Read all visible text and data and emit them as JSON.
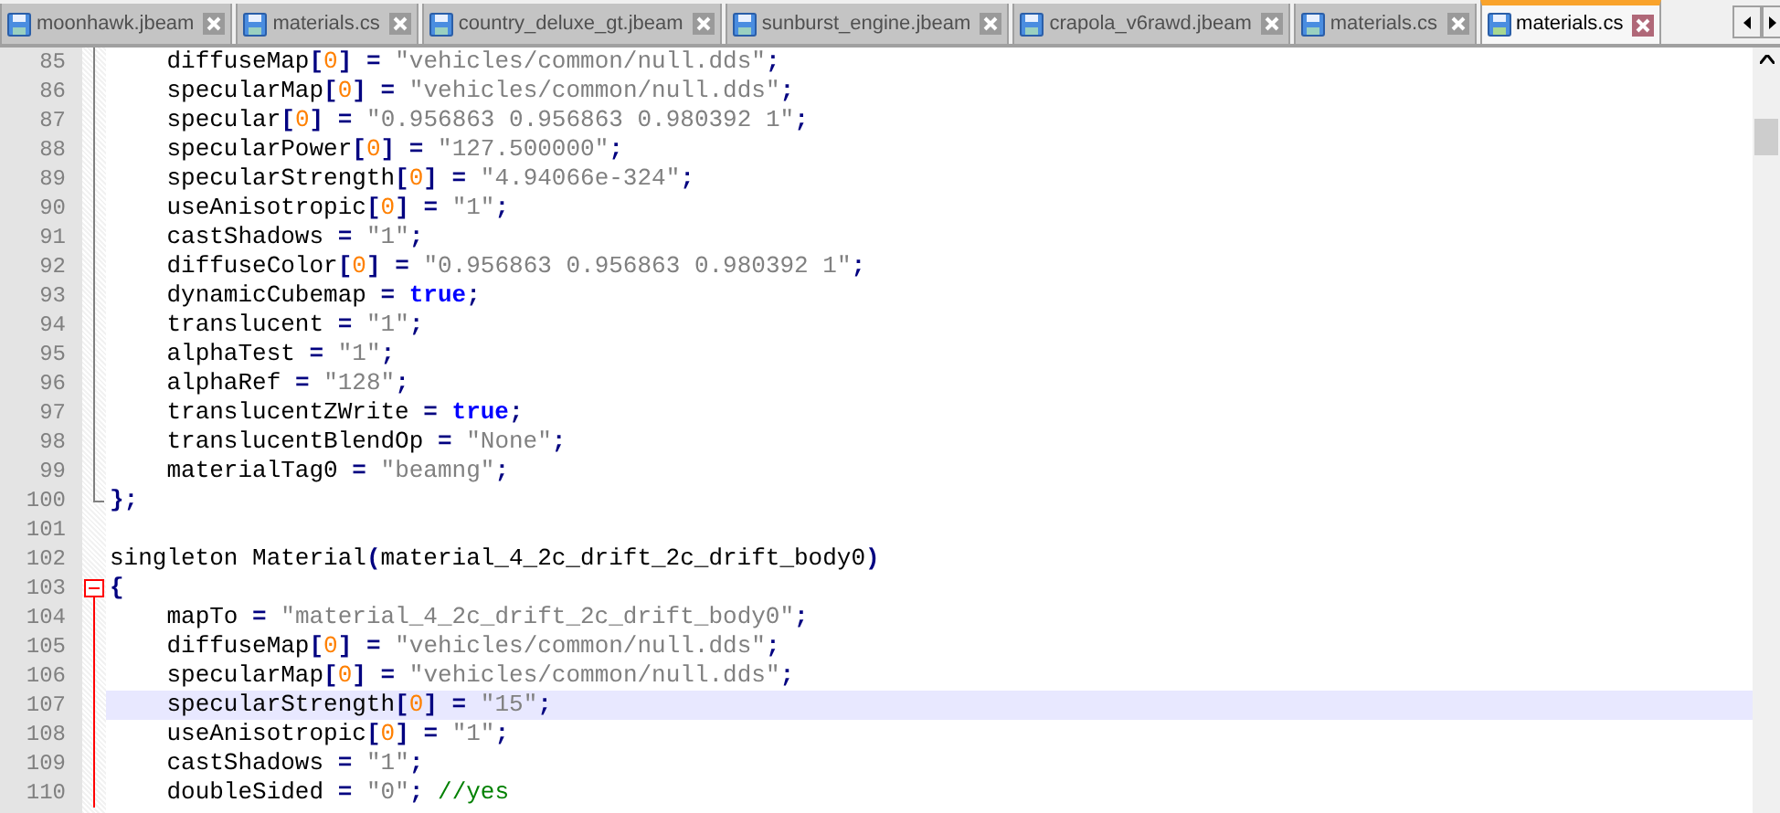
{
  "tabs": [
    {
      "label": "moonhawk.jbeam",
      "selected": false
    },
    {
      "label": "materials.cs",
      "selected": false
    },
    {
      "label": "country_deluxe_gt.jbeam",
      "selected": false
    },
    {
      "label": "sunburst_engine.jbeam",
      "selected": false
    },
    {
      "label": "crapola_v6rawd.jbeam",
      "selected": false
    },
    {
      "label": "materials.cs",
      "selected": false
    },
    {
      "label": "materials.cs",
      "selected": true
    }
  ],
  "lines": [
    {
      "number": "85",
      "code": "    diffuseMap[0] = \"vehicles/common/null.dds\";",
      "current": false,
      "kind": "body",
      "in_active_block": false
    },
    {
      "number": "86",
      "code": "    specularMap[0] = \"vehicles/common/null.dds\";",
      "current": false,
      "kind": "body",
      "in_active_block": false
    },
    {
      "number": "87",
      "code": "    specular[0] = \"0.956863 0.956863 0.980392 1\";",
      "current": false,
      "kind": "body",
      "in_active_block": false
    },
    {
      "number": "88",
      "code": "    specularPower[0] = \"127.500000\";",
      "current": false,
      "kind": "body",
      "in_active_block": false
    },
    {
      "number": "89",
      "code": "    specularStrength[0] = \"4.94066e-324\";",
      "current": false,
      "kind": "body",
      "in_active_block": false
    },
    {
      "number": "90",
      "code": "    useAnisotropic[0] = \"1\";",
      "current": false,
      "kind": "body",
      "in_active_block": false
    },
    {
      "number": "91",
      "code": "    castShadows = \"1\";",
      "current": false,
      "kind": "body",
      "in_active_block": false
    },
    {
      "number": "92",
      "code": "    diffuseColor[0] = \"0.956863 0.956863 0.980392 1\";",
      "current": false,
      "kind": "body",
      "in_active_block": false
    },
    {
      "number": "93",
      "code": "    dynamicCubemap = true;",
      "current": false,
      "kind": "body",
      "in_active_block": false
    },
    {
      "number": "94",
      "code": "    translucent = \"1\";",
      "current": false,
      "kind": "body",
      "in_active_block": false
    },
    {
      "number": "95",
      "code": "    alphaTest = \"1\";",
      "current": false,
      "kind": "body",
      "in_active_block": false
    },
    {
      "number": "96",
      "code": "    alphaRef = \"128\";",
      "current": false,
      "kind": "body",
      "in_active_block": false
    },
    {
      "number": "97",
      "code": "    translucentZWrite = true;",
      "current": false,
      "kind": "body",
      "in_active_block": false
    },
    {
      "number": "98",
      "code": "    translucentBlendOp = \"None\";",
      "current": false,
      "kind": "body",
      "in_active_block": false
    },
    {
      "number": "99",
      "code": "    materialTag0 = \"beamng\";",
      "current": false,
      "kind": "body",
      "in_active_block": false
    },
    {
      "number": "100",
      "code": "};",
      "current": false,
      "kind": "end",
      "in_active_block": false
    },
    {
      "number": "101",
      "current": false,
      "kind": "plain"
    },
    {
      "number": "102",
      "code": "singleton Material(material_4_2c_drift_2c_drift_body0)",
      "current": false,
      "kind": "plain"
    },
    {
      "number": "103",
      "code": "{",
      "current": false,
      "kind": "open",
      "in_active_block": true
    },
    {
      "number": "104",
      "code": "    mapTo = \"material_4_2c_drift_2c_drift_body0\";",
      "current": false,
      "kind": "body",
      "in_active_block": true
    },
    {
      "number": "105",
      "code": "    diffuseMap[0] = \"vehicles/common/null.dds\";",
      "current": false,
      "kind": "body",
      "in_active_block": true
    },
    {
      "number": "106",
      "code": "    specularMap[0] = \"vehicles/common/null.dds\";",
      "current": false,
      "kind": "body",
      "in_active_block": true
    },
    {
      "number": "107",
      "code": "    specularStrength[0] = \"15\";",
      "current": true,
      "kind": "body",
      "in_active_block": true
    },
    {
      "number": "108",
      "code": "    useAnisotropic[0] = \"1\";",
      "current": false,
      "kind": "body",
      "in_active_block": true
    },
    {
      "number": "109",
      "code": "    castShadows = \"1\";",
      "current": false,
      "kind": "body",
      "in_active_block": true
    },
    {
      "number": "110",
      "code": "    doubleSided = \"0\"; //yes",
      "current": false,
      "kind": "body",
      "in_active_block": true
    }
  ]
}
